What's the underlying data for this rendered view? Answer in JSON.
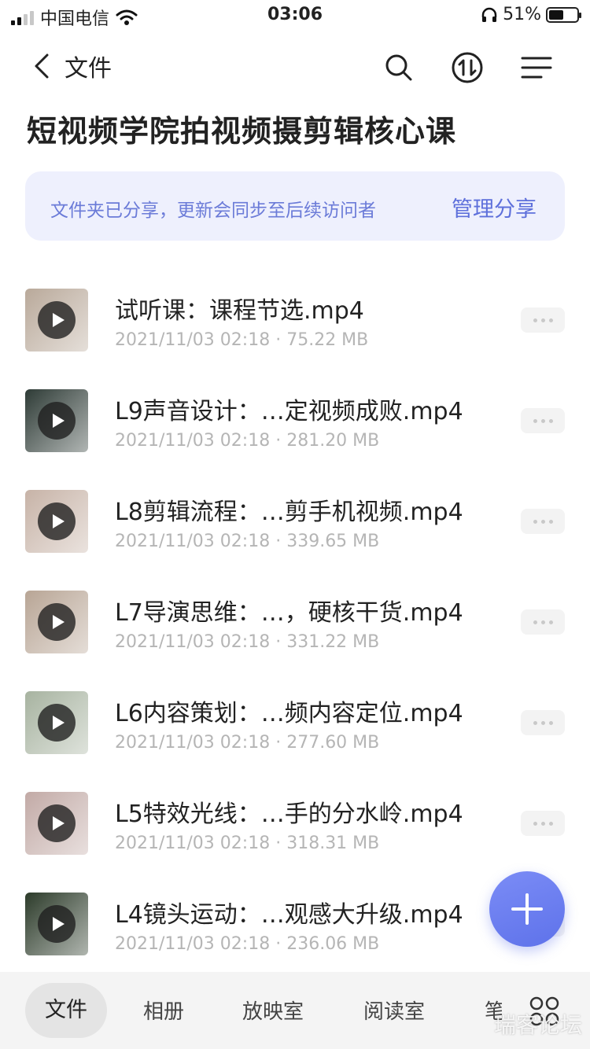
{
  "status": {
    "carrier": "中国电信",
    "time": "03:06",
    "battery": "51%"
  },
  "nav": {
    "back_label": "文件"
  },
  "page_title": "短视频学院拍视频摄剪辑核心课",
  "banner": {
    "message": "文件夹已分享，更新会同步至后续访问者",
    "action": "管理分享"
  },
  "files": [
    {
      "name": "试听课：课程节选.mp4",
      "date": "2021/11/03 02:18",
      "size": "75.22 MB",
      "thumb_color": "#b9a99a"
    },
    {
      "name": "L9声音设计：…定视频成败.mp4",
      "date": "2021/11/03 02:18",
      "size": "281.20 MB",
      "thumb_color": "#2e3b36"
    },
    {
      "name": "L8剪辑流程：…剪手机视频.mp4",
      "date": "2021/11/03 02:18",
      "size": "339.65 MB",
      "thumb_color": "#c7b3a7"
    },
    {
      "name": "L7导演思维：…，硬核干货.mp4",
      "date": "2021/11/03 02:18",
      "size": "331.22 MB",
      "thumb_color": "#b8a595"
    },
    {
      "name": "L6内容策划：…频内容定位.mp4",
      "date": "2021/11/03 02:18",
      "size": "277.60 MB",
      "thumb_color": "#a7b3a0"
    },
    {
      "name": "L5特效光线：…手的分水岭.mp4",
      "date": "2021/11/03 02:18",
      "size": "318.31 MB",
      "thumb_color": "#c2aaa6"
    },
    {
      "name": "L4镜头运动：…观感大升级.mp4",
      "date": "2021/11/03 02:18",
      "size": "236.06 MB",
      "thumb_color": "#2c3b2a"
    }
  ],
  "meta_separator": "·",
  "tabs": [
    {
      "label": "文件"
    },
    {
      "label": "相册"
    },
    {
      "label": "放映室"
    },
    {
      "label": "阅读室"
    },
    {
      "label": "笔"
    }
  ],
  "watermark": "瑞客论坛",
  "colors": {
    "accent": "#5e70db",
    "banner_bg": "#eef0fd"
  }
}
